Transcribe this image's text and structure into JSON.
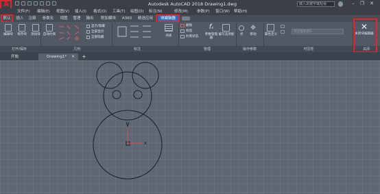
{
  "app": {
    "logo_letter": "A",
    "title": "Autodesk AutoCAD 2018    Drawing1.dwg"
  },
  "search": {
    "placeholder": "键入关键字或短语"
  },
  "menu": [
    "文件(F)",
    "编辑(E)",
    "视图(V)",
    "插入(I)",
    "格式(O)",
    "工具(T)",
    "绘图(D)",
    "标注(N)",
    "修改(M)",
    "参数(P)",
    "窗口(W)",
    "帮助(H)"
  ],
  "tabs": [
    "默认",
    "插入",
    "注释",
    "参数化",
    "视图",
    "管理",
    "输出",
    "附加模块",
    "A360",
    "精选应用",
    "块编辑器"
  ],
  "ribbon": {
    "groups": {
      "open_save": "打开/保存",
      "geometry": "几何",
      "dimension": "标注",
      "manage": "管理",
      "action_params": "操作参数",
      "visibility": "可见性",
      "close": "关闭"
    },
    "buttons": {
      "edit_block": "编辑块",
      "save_block": "保存块",
      "test_block": "测试块",
      "auto_constrain": "自动约束",
      "show_hide": "显示/隐藏",
      "show_all": "全部显示",
      "hide_all": "全部隐藏",
      "block_table": "块表",
      "delete": "删除",
      "construction": "构造",
      "constraint_status": "约束状态",
      "param_manager": "参数管理器",
      "authoring_palettes": "编写选项板",
      "point": "点",
      "move": "移动",
      "attr_def": "属性定义",
      "close_block_editor": "关闭块编辑器"
    },
    "visibility_state": "可见性状态0"
  },
  "doc_tabs": [
    "开始",
    "Drawing1*"
  ]
}
